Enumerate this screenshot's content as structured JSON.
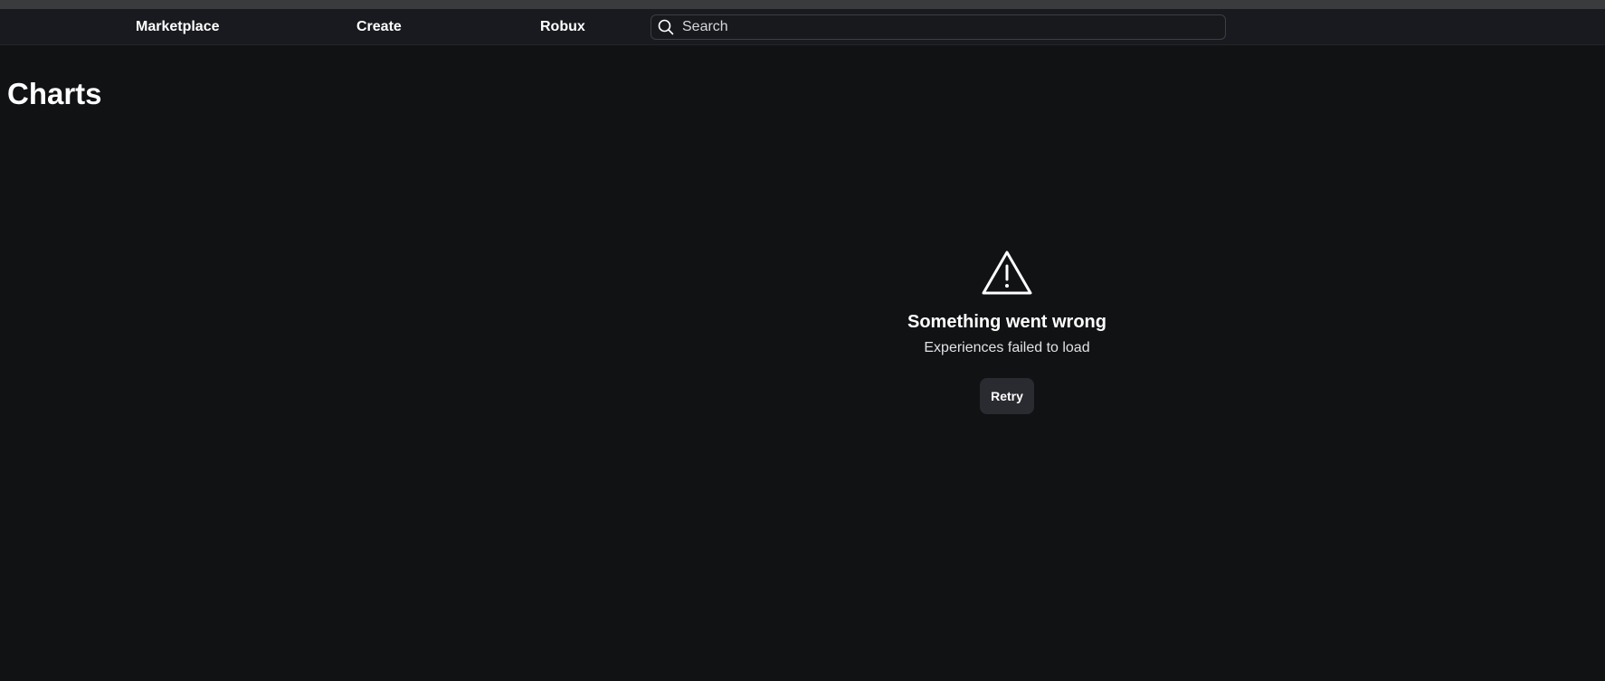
{
  "nav": {
    "links": [
      {
        "label": "Marketplace"
      },
      {
        "label": "Create"
      },
      {
        "label": "Robux"
      }
    ],
    "search": {
      "placeholder": "Search",
      "value": ""
    }
  },
  "page": {
    "title": "Charts"
  },
  "error": {
    "icon": "warning-triangle-icon",
    "title": "Something went wrong",
    "message": "Experiences failed to load",
    "retry_label": "Retry"
  },
  "colors": {
    "background": "#111214",
    "navbar": "#191a1f",
    "button": "#2a2b31",
    "text": "#ffffff"
  }
}
